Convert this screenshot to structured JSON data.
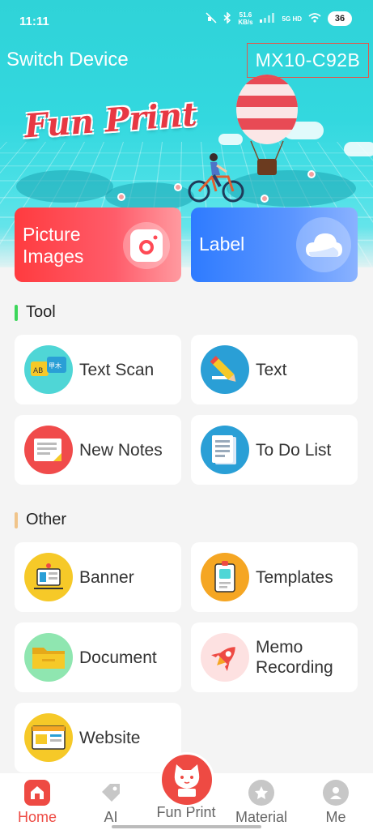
{
  "status_bar": {
    "time": "11:11",
    "net_speed": "51.6",
    "net_unit": "KB/s",
    "signal_label": "5G HD",
    "battery": "36"
  },
  "header": {
    "switch_device": "Switch Device",
    "device_id": "MX10-C92B",
    "logo_text": "Fun Print"
  },
  "cards": {
    "picture": "Picture\nImages",
    "label": "Label"
  },
  "sections": {
    "tool": "Tool",
    "other": "Other"
  },
  "tools": [
    {
      "label": "Text Scan",
      "icon": "text-scan-icon",
      "color": "#4fd6d6"
    },
    {
      "label": "Text",
      "icon": "pencil-icon",
      "color": "#2a9fd6"
    },
    {
      "label": "New Notes",
      "icon": "notes-icon",
      "color": "#f04b4b"
    },
    {
      "label": "To Do List",
      "icon": "todo-list-icon",
      "color": "#2a9fd6"
    }
  ],
  "other": [
    {
      "label": "Banner",
      "icon": "banner-icon",
      "color": "#f6c928"
    },
    {
      "label": "Templates",
      "icon": "templates-icon",
      "color": "#f5a623"
    },
    {
      "label": "Document",
      "icon": "folder-icon",
      "color": "#8fe6b0"
    },
    {
      "label": "Memo\nRecording",
      "icon": "rocket-icon",
      "color": "#fde1e1"
    },
    {
      "label": "Website",
      "icon": "website-icon",
      "color": "#f6c928"
    }
  ],
  "bottom_nav": {
    "home": "Home",
    "ai": "AI",
    "fun_print": "Fun Print",
    "material": "Material",
    "me": "Me"
  },
  "colors": {
    "accent": "#ee4a43",
    "hero": "#33d8df",
    "picture_card": "#ff3b3f",
    "label_card": "#2e7bff"
  }
}
